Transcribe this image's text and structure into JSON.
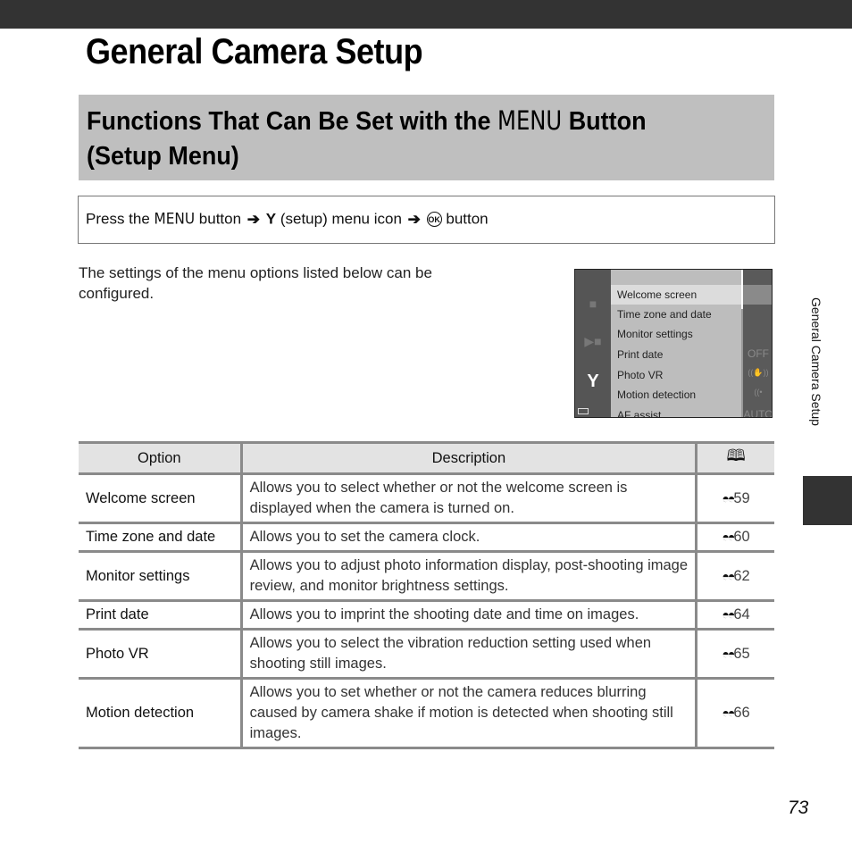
{
  "page": {
    "title": "General Camera Setup",
    "number": "73",
    "side_label": "General Camera Setup"
  },
  "section": {
    "title_part1": "Functions That Can Be Set with the ",
    "menu_glyph": "MENU",
    "title_part2": " Button",
    "title_line2": "(Setup Menu)"
  },
  "navigation": {
    "press_the": "Press the",
    "menu_glyph": "MENU",
    "button_text": "button",
    "arrow": "➔",
    "setup_icon": "Y",
    "setup_text": "(setup) menu icon",
    "ok_icon": "OK",
    "button_text2": "button"
  },
  "intro_text": "The settings of the menu options listed below can be configured.",
  "camera_screen": {
    "icons": {
      "camera": "camera-icon",
      "movie": "movie-camera-icon",
      "setup": "wrench-icon",
      "battery": "battery-icon"
    },
    "items": [
      {
        "label": "Welcome screen",
        "value": "",
        "selected": true
      },
      {
        "label": "Time zone and date",
        "value": ""
      },
      {
        "label": "Monitor settings",
        "value": ""
      },
      {
        "label": "Print date",
        "value": "OFF"
      },
      {
        "label": "Photo VR",
        "value": "((✋))"
      },
      {
        "label": "Motion detection",
        "value": "((•"
      },
      {
        "label": "AF assist",
        "value": "AUTO"
      }
    ]
  },
  "table": {
    "headers": {
      "option": "Option",
      "description": "Description",
      "page_ref": "book-icon"
    },
    "ref_icon": "binoculars-icon",
    "rows": [
      {
        "option": "Welcome screen",
        "description": "Allows you to select whether or not the welcome screen is displayed when the camera is turned on.",
        "page": "59"
      },
      {
        "option": "Time zone and date",
        "description": "Allows you to set the camera clock.",
        "page": "60"
      },
      {
        "option": "Monitor settings",
        "description": "Allows you to adjust photo information display, post-shooting image review, and monitor brightness settings.",
        "page": "62"
      },
      {
        "option": "Print date",
        "description": "Allows you to imprint the shooting date and time on images.",
        "page": "64"
      },
      {
        "option": "Photo VR",
        "description": "Allows you to select the vibration reduction setting used when shooting still images.",
        "page": "65"
      },
      {
        "option": "Motion detection",
        "description": "Allows you to set whether or not the camera reduces blurring caused by camera shake if motion is detected when shooting still images.",
        "page": "66"
      }
    ]
  }
}
